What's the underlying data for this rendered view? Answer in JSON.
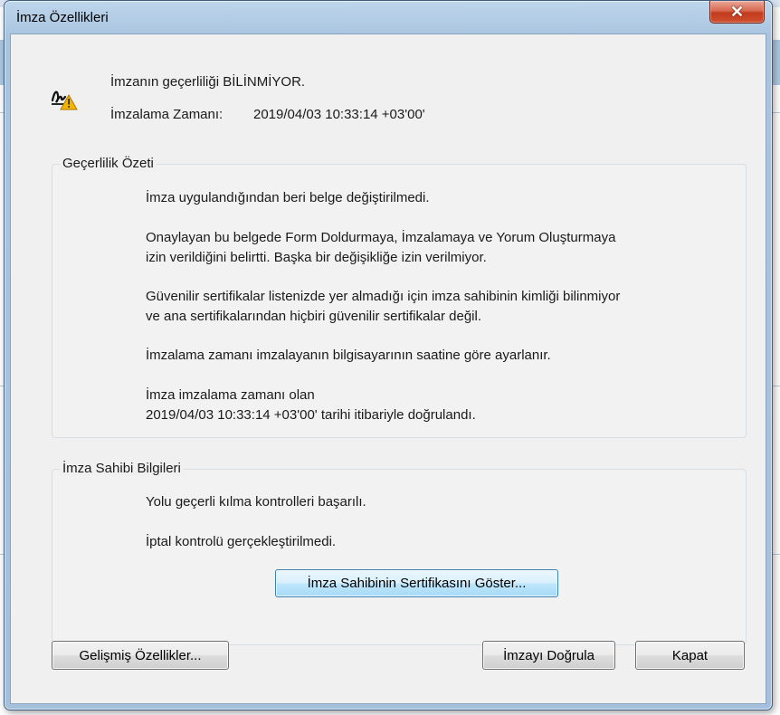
{
  "window": {
    "title": "İmza Özellikleri"
  },
  "header": {
    "validity_text": "İmzanın geçerliliği BİLİNMİYOR.",
    "signing_time_label": "İmzalama Zamanı:",
    "signing_time_value": "2019/04/03 10:33:14 +03'00'"
  },
  "validity_summary": {
    "title": "Geçerlilik Özeti",
    "lines": [
      "İmza uygulandığından beri belge değiştirilmedi.",
      "Onaylayan bu belgede Form Doldurmaya, İmzalamaya ve Yorum Oluşturmaya",
      "izin verildiğini belirtti. Başka bir değişikliğe izin verilmiyor.",
      "Güvenilir sertifikalar listenizde yer almadığı için imza sahibinin kimliği bilinmiyor",
      "ve ana sertifikalarından hiçbiri güvenilir sertifikalar değil.",
      "İmzalama zamanı imzalayanın bilgisayarının saatine göre ayarlanır.",
      "İmza imzalama zamanı olan",
      "2019/04/03 10:33:14 +03'00' tarihi itibariyle doğrulandı."
    ]
  },
  "signer_info": {
    "title": "İmza Sahibi Bilgileri",
    "lines": [
      "Yolu geçerli kılma kontrolleri başarılı.",
      "İptal kontrolü gerçekleştirilmedi."
    ],
    "show_cert_button": "İmza Sahibinin Sertifikasını Göster..."
  },
  "footer": {
    "advanced_button": "Gelişmiş Özellikler...",
    "validate_button": "İmzayı Doğrula",
    "close_button": "Kapat"
  },
  "icons": {
    "signature_icon": "signature-warning-icon",
    "close_icon": "close-icon"
  },
  "colors": {
    "frame": "#a9c4df",
    "client": "#f0f0f0",
    "close_button": "#c23b1d",
    "focus_button": "#bee6fd"
  }
}
